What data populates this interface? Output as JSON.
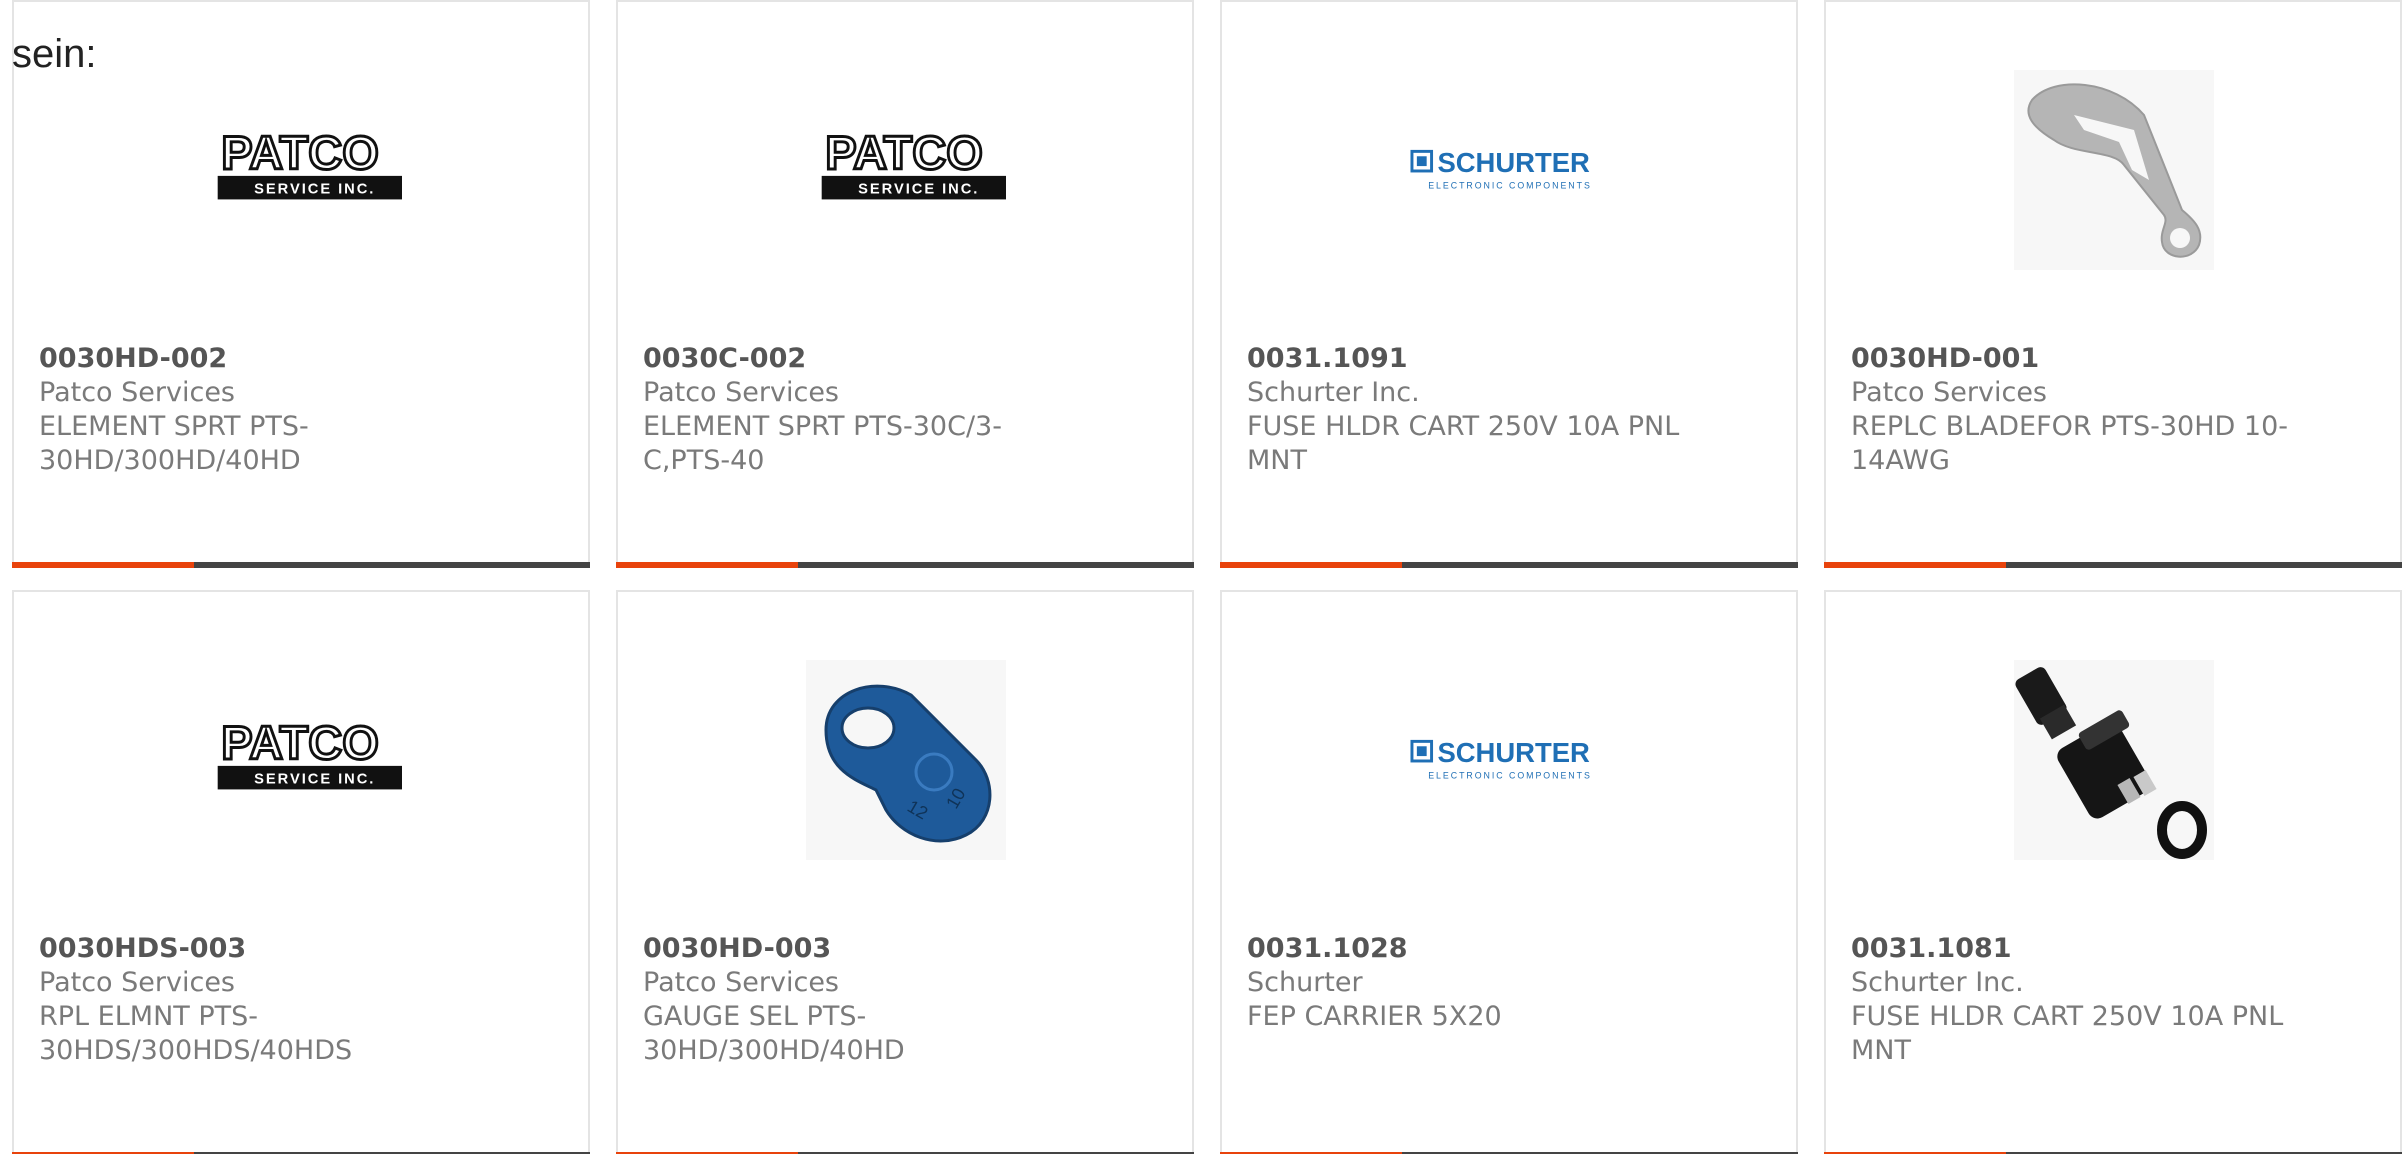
{
  "heading": "sein:",
  "colors": {
    "accent": "#e8430c",
    "bar": "#444444",
    "border": "#e4e4e4",
    "schurter_blue": "#1f6fb5",
    "text": "#7a7a7a"
  },
  "products": [
    {
      "part_number": "0030HD-002",
      "manufacturer": "Patco Services",
      "description": "ELEMENT SPRT PTS-30HD/300HD/40HD",
      "image": "patco-logo"
    },
    {
      "part_number": "0030C-002",
      "manufacturer": "Patco Services",
      "description": "ELEMENT SPRT PTS-30C/3-C,PTS-40",
      "image": "patco-logo"
    },
    {
      "part_number": "0031.1091",
      "manufacturer": "Schurter Inc.",
      "description": "FUSE HLDR CART 250V 10A PNL MNT",
      "image": "schurter-logo"
    },
    {
      "part_number": "0030HD-001",
      "manufacturer": "Patco Services",
      "description": "REPLC BLADEFOR PTS-30HD 10-14AWG",
      "image": "replacement-blade-photo"
    },
    {
      "part_number": "0030HDS-003",
      "manufacturer": "Patco Services",
      "description": "RPL ELMNT PTS-30HDS/300HDS/40HDS",
      "image": "patco-logo"
    },
    {
      "part_number": "0030HD-003",
      "manufacturer": "Patco Services",
      "description": "GAUGE SEL PTS-30HD/300HD/40HD",
      "image": "gauge-selector-photo"
    },
    {
      "part_number": "0031.1028",
      "manufacturer": "Schurter",
      "description": "FEP CARRIER 5X20",
      "image": "schurter-logo"
    },
    {
      "part_number": "0031.1081",
      "manufacturer": "Schurter Inc.",
      "description": "FUSE HLDR CART 250V 10A PNL MNT",
      "image": "fuse-holder-photo"
    }
  ],
  "logos": {
    "patco": {
      "word": "PATCO",
      "tagline": "SERVICE INC."
    },
    "schurter": {
      "word": "SCHURTER",
      "tagline": "ELECTRONIC COMPONENTS"
    }
  },
  "photo_labels": {
    "gauge_left": "12",
    "gauge_right": "10"
  }
}
